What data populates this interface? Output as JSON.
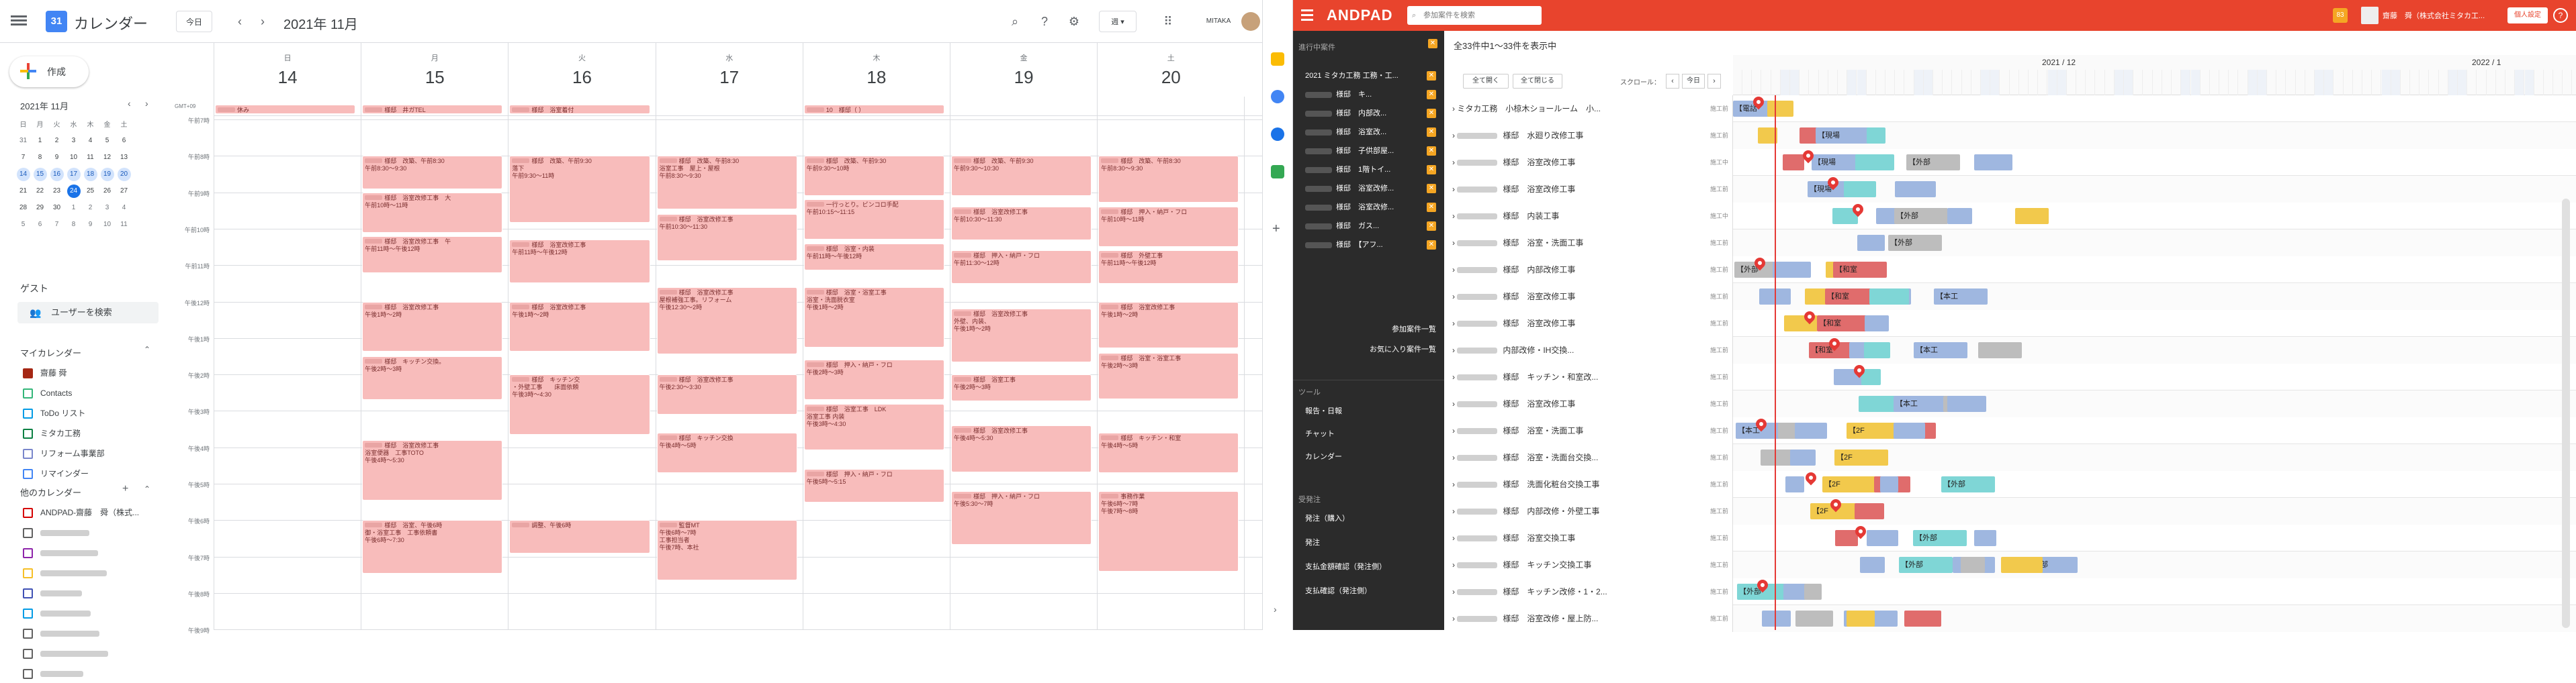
{
  "gcal": {
    "app_title": "カレンダー",
    "today_button": "今日",
    "period_label": "2021年 11月",
    "view_button": "週",
    "account_label": "MITAKA",
    "create_label": "作成",
    "mini_month": "2021年 11月",
    "mini_weekdays": [
      "日",
      "月",
      "火",
      "水",
      "木",
      "金",
      "土"
    ],
    "mini_weeks": [
      [
        "31",
        "1",
        "2",
        "3",
        "4",
        "5",
        "6"
      ],
      [
        "7",
        "8",
        "9",
        "10",
        "11",
        "12",
        "13"
      ],
      [
        "14",
        "15",
        "16",
        "17",
        "18",
        "19",
        "20"
      ],
      [
        "21",
        "22",
        "23",
        "24",
        "25",
        "26",
        "27"
      ],
      [
        "28",
        "29",
        "30",
        "1",
        "2",
        "3",
        "4"
      ],
      [
        "5",
        "6",
        "7",
        "8",
        "9",
        "10",
        "11"
      ]
    ],
    "guest_heading": "ゲスト",
    "search_users": "ユーザーを検索",
    "my_calendars_heading": "マイカレンダー",
    "my_calendars": [
      {
        "label": "齋藤 舜",
        "color": "#a52714",
        "checked": true
      },
      {
        "label": "Contacts",
        "color": "#33b679",
        "checked": false
      },
      {
        "label": "ToDo リスト",
        "color": "#039be5",
        "checked": false
      },
      {
        "label": "ミタカ工務",
        "color": "#0b8043",
        "checked": false
      },
      {
        "label": "リフォーム事業部",
        "color": "#7986cb",
        "checked": false
      },
      {
        "label": "リマインダー",
        "color": "#4285f4",
        "checked": false
      }
    ],
    "other_calendars_heading": "他のカレンダー",
    "other_calendars": [
      {
        "label": "ANDPAD-齋藤　舜（株式...",
        "color": "#d50000"
      },
      {
        "label": "",
        "color": "#616161"
      },
      {
        "label": "",
        "color": "#8e24aa"
      },
      {
        "label": "",
        "color": "#f6bf26"
      },
      {
        "label": "",
        "color": "#3f51b5"
      },
      {
        "label": "",
        "color": "#039be5"
      },
      {
        "label": "",
        "color": "#616161"
      },
      {
        "label": "",
        "color": "#616161"
      },
      {
        "label": "",
        "color": "#616161"
      }
    ],
    "tz_label": "GMT+09",
    "days": [
      {
        "name": "日",
        "num": "14"
      },
      {
        "name": "月",
        "num": "15"
      },
      {
        "name": "火",
        "num": "16"
      },
      {
        "name": "水",
        "num": "17"
      },
      {
        "name": "木",
        "num": "18"
      },
      {
        "name": "金",
        "num": "19"
      },
      {
        "name": "土",
        "num": "20"
      }
    ],
    "hours": [
      "午前7時",
      "午前8時",
      "午前9時",
      "午前10時",
      "午前11時",
      "午後12時",
      "午後1時",
      "午後2時",
      "午後3時",
      "午後4時",
      "午後5時",
      "午後6時",
      "午後7時",
      "午後8時",
      "午後9時"
    ],
    "events": [
      {
        "day": 0,
        "start": 0.0,
        "end": 0.5,
        "text": "休み"
      },
      {
        "day": 1,
        "start": 0.0,
        "end": 0.5,
        "text": "様邸　井ガTEL"
      },
      {
        "day": 2,
        "start": 0.0,
        "end": 0.5,
        "text": "様邸　浴室着付"
      },
      {
        "day": 4,
        "start": 0.0,
        "end": 0.5,
        "text": "10　様邸（ ）"
      },
      {
        "day": 1,
        "start": 4.0,
        "end": 5.0,
        "text": "様邸　改築、午前8:30\n午前8:30～9:30"
      },
      {
        "day": 1,
        "start": 5.0,
        "end": 6.2,
        "text": "様邸　浴室改修工事　大\n午前10時～11時"
      },
      {
        "day": 1,
        "start": 6.2,
        "end": 7.3,
        "text": "様邸　浴室改修工事　午\n午前11時～午後12時"
      },
      {
        "day": 1,
        "start": 8.0,
        "end": 9.5,
        "text": "様邸　浴室改修工事\n午後1時～2時"
      },
      {
        "day": 1,
        "start": 9.5,
        "end": 10.8,
        "text": "様邸　キッチン交換。\n午後2時～3時"
      },
      {
        "day": 1,
        "start": 11.8,
        "end": 13.6,
        "text": "様邸　浴室改修工事\n浴室便器　工事TOTO\n午後4時～5:30"
      },
      {
        "day": 1,
        "start": 14.0,
        "end": 15.6,
        "text": "様邸　浴室、午後6時\n御・浴室工事　工事依頼書\n午後6時～7:30"
      },
      {
        "day": 2,
        "start": 4.0,
        "end": 6.0,
        "text": "様邸　改築、午前9:30\n落下\n午前9:30～11時"
      },
      {
        "day": 2,
        "start": 6.3,
        "end": 7.6,
        "text": "様邸　浴室改修工事\n午前11時～午後12時"
      },
      {
        "day": 2,
        "start": 8.0,
        "end": 9.5,
        "text": "様邸　浴室改修工事\n午後1時～2時"
      },
      {
        "day": 2,
        "start": 10.0,
        "end": 11.8,
        "text": "様邸　キッチン交\n・外壁工事　　床面依頼\n午後3時～4:30"
      },
      {
        "day": 2,
        "start": 14.0,
        "end": 15.0,
        "text": "調整、午後6時"
      },
      {
        "day": 3,
        "start": 4.0,
        "end": 5.6,
        "text": "様邸　改築、午前8:30\n浴室工事　屋上・屋根\n午前8:30～9:30"
      },
      {
        "day": 3,
        "start": 5.6,
        "end": 7.0,
        "text": "様邸　浴室改修工事\n午前10:30～11:30"
      },
      {
        "day": 3,
        "start": 7.6,
        "end": 9.6,
        "text": "様邸　浴室改修工事\n屋根補強工事。リフォーム\n午後12:30～2時"
      },
      {
        "day": 3,
        "start": 10.0,
        "end": 11.2,
        "text": "様邸　浴室改修工事\n午後2:30～3:30"
      },
      {
        "day": 3,
        "start": 11.6,
        "end": 12.8,
        "text": "様邸　キッチン交換\n午後4時～5時"
      },
      {
        "day": 3,
        "start": 14.0,
        "end": 15.8,
        "text": "監督MT\n午後6時～7時\n工事担当者\n午後7時、本社"
      },
      {
        "day": 4,
        "start": 4.0,
        "end": 5.2,
        "text": "様邸　改築、午前9:30\n午前9:30～10時"
      },
      {
        "day": 4,
        "start": 5.2,
        "end": 6.4,
        "text": "一行っとり。ビンコロ手配\n午前10:15～11:15"
      },
      {
        "day": 4,
        "start": 6.4,
        "end": 7.2,
        "text": "様邸　浴室・内装\n午前11時～午後12時"
      },
      {
        "day": 4,
        "start": 7.6,
        "end": 9.4,
        "text": "様邸　浴室・浴室工事\n浴室・洗面脱衣室\n午後1時～2時"
      },
      {
        "day": 4,
        "start": 9.6,
        "end": 10.8,
        "text": "様邸　押入・納戸・フロ\n午後2時～3時"
      },
      {
        "day": 4,
        "start": 10.8,
        "end": 12.2,
        "text": "様邸　浴室工事　LDK\n浴室工事 内装\n午後3時～4:30"
      },
      {
        "day": 4,
        "start": 12.6,
        "end": 13.6,
        "text": "様邸　押入・納戸・フロ\n午後5時～5:15"
      },
      {
        "day": 5,
        "start": 4.0,
        "end": 5.2,
        "text": "様邸　改築、午前9:30\n午前9:30～10:30"
      },
      {
        "day": 5,
        "start": 5.4,
        "end": 6.4,
        "text": "様邸　浴室改修工事\n午前10:30～11:30"
      },
      {
        "day": 5,
        "start": 6.6,
        "end": 7.6,
        "text": "様邸　押入・納戸・フロ\n午前11:30～12時"
      },
      {
        "day": 5,
        "start": 8.2,
        "end": 9.8,
        "text": "様邸　浴室改修工事\n外壁、内装、\n午後1時～2時"
      },
      {
        "day": 5,
        "start": 10.0,
        "end": 10.8,
        "text": "様邸　浴室工事\n午後2時～3時"
      },
      {
        "day": 5,
        "start": 11.4,
        "end": 12.8,
        "text": "様邸　浴室改修工事\n午後4時～5:30"
      },
      {
        "day": 5,
        "start": 13.2,
        "end": 14.8,
        "text": "様邸　押入・納戸・フロ\n午後5:30～7時"
      },
      {
        "day": 6,
        "start": 4.0,
        "end": 5.4,
        "text": "様邸　改築、午前8:30\n午前8:30～9:30"
      },
      {
        "day": 6,
        "start": 5.4,
        "end": 6.6,
        "text": "様邸　押入・納戸・フロ\n午前10時～11時"
      },
      {
        "day": 6,
        "start": 6.6,
        "end": 7.6,
        "text": "様邸　外壁工事\n午前11時～午後12時"
      },
      {
        "day": 6,
        "start": 8.0,
        "end": 9.4,
        "text": "様邸　浴室改修工事\n午後1時～2時"
      },
      {
        "day": 6,
        "start": 9.4,
        "end": 10.8,
        "text": "様邸　浴室・浴室工事\n午後2時～3時"
      },
      {
        "day": 6,
        "start": 11.6,
        "end": 12.8,
        "text": "様邸　キッチン・和室\n午後4時～5時"
      },
      {
        "day": 6,
        "start": 13.2,
        "end": 15.6,
        "text": "事務作業\n午後6時～7時\n午後7時～8時"
      }
    ]
  },
  "andpad": {
    "logo": "ANDPAD",
    "search_placeholder": "参加案件を検索",
    "user_name": "齋藤　舜（株式会社ミタカ工...",
    "settings_label": "個人設定",
    "count_text": "全33件中1〜33件を表示中",
    "btn_expand": "全て開く",
    "btn_collapse": "全て閉じる",
    "scroll_label": "スクロール：",
    "today_btn": "今日",
    "month1": "2021 / 12",
    "month2": "2022 / 1",
    "side_projects_heading": "進行中案件",
    "side_projects": [
      "2021 ミタカ工務 工務・工...",
      "様邸　キ...",
      "様邸　内部改...",
      "様邸　浴室改...",
      "様邸　子供部屋...",
      "様邸　1階トイ...",
      "様邸　浴室改修...",
      "様邸　浴室改修...",
      "様邸　ガス...",
      "様邸　【アフ..."
    ],
    "side_links": [
      "参加案件一覧",
      "お気に入り案件一覧"
    ],
    "tools_heading": "ツール",
    "tools": [
      "報告・日報",
      "チャット",
      "カレンダー"
    ],
    "orders_heading": "受発注",
    "orders": [
      "発注（購入）",
      "発注",
      "支払金額確認（発注側）",
      "支払確認（発注側）"
    ],
    "rows": [
      {
        "name": "ミタカ工務　小椋木ショールーム　小...",
        "status": "施工前"
      },
      {
        "name": "様邸　水廻り改修工事",
        "status": "施工前"
      },
      {
        "name": "様邸　浴室改修工事",
        "status": "施工中"
      },
      {
        "name": "様邸　浴室改修工事",
        "status": "施工前"
      },
      {
        "name": "様邸　内装工事",
        "status": "施工中"
      },
      {
        "name": "様邸　浴室・洗面工事",
        "status": "施工前"
      },
      {
        "name": "様邸　内部改修工事",
        "status": "施工前"
      },
      {
        "name": "様邸　浴室改修工事",
        "status": "施工前"
      },
      {
        "name": "様邸　浴室改修工事",
        "status": "施工前"
      },
      {
        "name": "内部改修・IH交換...",
        "status": "施工前"
      },
      {
        "name": "様邸　キッチン・和室改...",
        "status": "施工前"
      },
      {
        "name": "様邸　浴室改修工事",
        "status": "施工前"
      },
      {
        "name": "様邸　浴室・洗面工事",
        "status": "施工前"
      },
      {
        "name": "様邸　浴室・洗面台交換...",
        "status": "施工前"
      },
      {
        "name": "様邸　洗面化粧台交換工事",
        "status": "施工前"
      },
      {
        "name": "様邸　内部改修・外壁工事",
        "status": "施工前"
      },
      {
        "name": "様邸　浴室交換工事",
        "status": "施工前"
      },
      {
        "name": "様邸　キッチン交換工事",
        "status": "施工前"
      },
      {
        "name": "様邸　キッチン改修・1・2...",
        "status": "施工前"
      },
      {
        "name": "様邸　浴室改修・屋上防...",
        "status": "施工前"
      }
    ],
    "colors": {
      "blue": "#9fb7e0",
      "yellow": "#f2c94c",
      "red": "#e06c6c",
      "teal": "#7fd6d6",
      "gray": "#bdbdbd"
    },
    "bar_labels": [
      "【電話",
      "【外部",
      "【外部",
      "【現場",
      "【内装",
      "【外部",
      "【外部",
      "【1F",
      "【1F",
      "【和室",
      "【浴室",
      "【谷",
      "【本工",
      "【再FF",
      "【1F",
      "【2F"
    ]
  }
}
